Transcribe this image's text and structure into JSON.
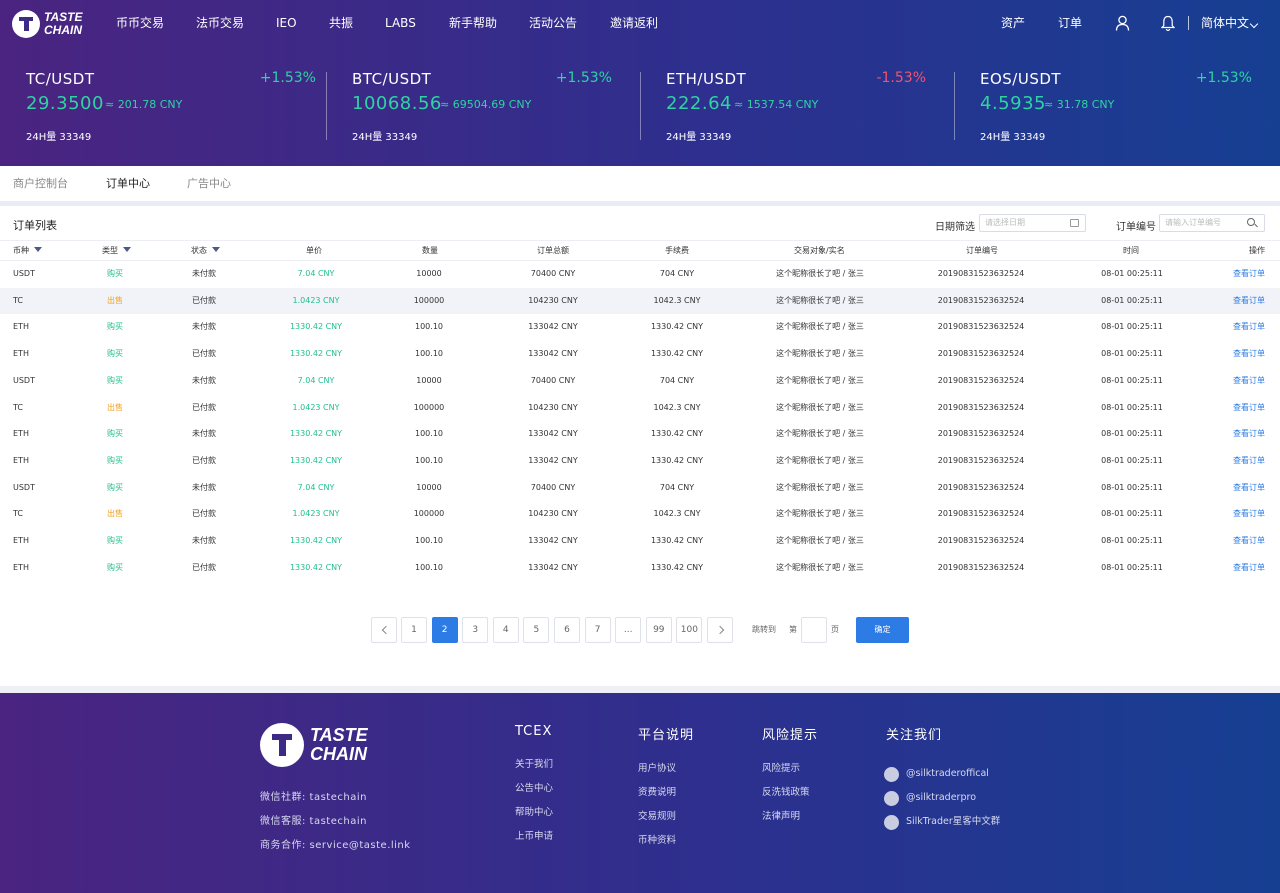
{
  "brand": {
    "line1": "TASTE",
    "line2": "CHAIN"
  },
  "nav": {
    "items": [
      "币币交易",
      "法币交易",
      "IEO",
      "共振",
      "LABS",
      "新手帮助",
      "活动公告",
      "邀请返利"
    ],
    "assets": "资产",
    "orders": "订单",
    "language": "简体中文",
    "user_icon": "user-icon",
    "bell_icon": "bell-icon"
  },
  "tickers": [
    {
      "pair": "TC/USDT",
      "change": "+1.53%",
      "change_color": "#2fd3a3",
      "price": "29.3500",
      "cny": "≈ 201.78 CNY",
      "volume": "24H量 33349"
    },
    {
      "pair": "BTC/USDT",
      "change": "+1.53%",
      "change_color": "#2fd3a3",
      "price": "10068.56",
      "cny": "≈ 69504.69 CNY",
      "volume": "24H量 33349"
    },
    {
      "pair": "ETH/USDT",
      "change": "-1.53%",
      "change_color": "#f2536b",
      "price": "222.64",
      "cny": "≈ 1537.54 CNY",
      "volume": "24H量 33349"
    },
    {
      "pair": "EOS/USDT",
      "change": "+1.53%",
      "change_color": "#2fd3a3",
      "price": "4.5935",
      "cny": "≈ 31.78 CNY",
      "volume": "24H量 33349"
    }
  ],
  "tabs": [
    "商户控制台",
    "订单中心",
    "广告中心"
  ],
  "active_tab": 1,
  "list": {
    "title": "订单列表",
    "date_label": "日期筛选",
    "date_placeholder": "请选择日期",
    "order_label": "订单编号",
    "order_placeholder": "请输入订单编号"
  },
  "columns": [
    "币种",
    "类型",
    "状态",
    "单价",
    "数量",
    "订单总额",
    "手续费",
    "交易对象/实名",
    "订单编号",
    "时间",
    "操作"
  ],
  "rows": [
    {
      "coin": "USDT",
      "type": "购买",
      "status": "未付款",
      "price": "7.04 CNY",
      "qty": "10000",
      "total": "70400 CNY",
      "fee": "704 CNY",
      "party": "这个昵称很长了吧 / 张三",
      "order_no": "20190831523632524",
      "time": "08-01 00:25:11",
      "action": "查看订单"
    },
    {
      "coin": "TC",
      "type": "出售",
      "status": "已付款",
      "price": "1.0423 CNY",
      "qty": "100000",
      "total": "104230 CNY",
      "fee": "1042.3 CNY",
      "party": "这个昵称很长了吧 / 张三",
      "order_no": "20190831523632524",
      "time": "08-01 00:25:11",
      "action": "查看订单"
    },
    {
      "coin": "ETH",
      "type": "购买",
      "status": "未付款",
      "price": "1330.42 CNY",
      "qty": "100.10",
      "total": "133042 CNY",
      "fee": "1330.42 CNY",
      "party": "这个昵称很长了吧 / 张三",
      "order_no": "20190831523632524",
      "time": "08-01 00:25:11",
      "action": "查看订单"
    },
    {
      "coin": "ETH",
      "type": "购买",
      "status": "已付款",
      "price": "1330.42 CNY",
      "qty": "100.10",
      "total": "133042 CNY",
      "fee": "1330.42 CNY",
      "party": "这个昵称很长了吧 / 张三",
      "order_no": "20190831523632524",
      "time": "08-01 00:25:11",
      "action": "查看订单"
    },
    {
      "coin": "USDT",
      "type": "购买",
      "status": "未付款",
      "price": "7.04 CNY",
      "qty": "10000",
      "total": "70400 CNY",
      "fee": "704 CNY",
      "party": "这个昵称很长了吧 / 张三",
      "order_no": "20190831523632524",
      "time": "08-01 00:25:11",
      "action": "查看订单"
    },
    {
      "coin": "TC",
      "type": "出售",
      "status": "已付款",
      "price": "1.0423 CNY",
      "qty": "100000",
      "total": "104230 CNY",
      "fee": "1042.3 CNY",
      "party": "这个昵称很长了吧 / 张三",
      "order_no": "20190831523632524",
      "time": "08-01 00:25:11",
      "action": "查看订单"
    },
    {
      "coin": "ETH",
      "type": "购买",
      "status": "未付款",
      "price": "1330.42 CNY",
      "qty": "100.10",
      "total": "133042 CNY",
      "fee": "1330.42 CNY",
      "party": "这个昵称很长了吧 / 张三",
      "order_no": "20190831523632524",
      "time": "08-01 00:25:11",
      "action": "查看订单"
    },
    {
      "coin": "ETH",
      "type": "购买",
      "status": "已付款",
      "price": "1330.42 CNY",
      "qty": "100.10",
      "total": "133042 CNY",
      "fee": "1330.42 CNY",
      "party": "这个昵称很长了吧 / 张三",
      "order_no": "20190831523632524",
      "time": "08-01 00:25:11",
      "action": "查看订单"
    },
    {
      "coin": "USDT",
      "type": "购买",
      "status": "未付款",
      "price": "7.04 CNY",
      "qty": "10000",
      "total": "70400 CNY",
      "fee": "704 CNY",
      "party": "这个昵称很长了吧 / 张三",
      "order_no": "20190831523632524",
      "time": "08-01 00:25:11",
      "action": "查看订单"
    },
    {
      "coin": "TC",
      "type": "出售",
      "status": "已付款",
      "price": "1.0423 CNY",
      "qty": "100000",
      "total": "104230 CNY",
      "fee": "1042.3 CNY",
      "party": "这个昵称很长了吧 / 张三",
      "order_no": "20190831523632524",
      "time": "08-01 00:25:11",
      "action": "查看订单"
    },
    {
      "coin": "ETH",
      "type": "购买",
      "status": "未付款",
      "price": "1330.42 CNY",
      "qty": "100.10",
      "total": "133042 CNY",
      "fee": "1330.42 CNY",
      "party": "这个昵称很长了吧 / 张三",
      "order_no": "20190831523632524",
      "time": "08-01 00:25:11",
      "action": "查看订单"
    },
    {
      "coin": "ETH",
      "type": "购买",
      "status": "已付款",
      "price": "1330.42 CNY",
      "qty": "100.10",
      "total": "133042 CNY",
      "fee": "1330.42 CNY",
      "party": "这个昵称很长了吧 / 张三",
      "order_no": "20190831523632524",
      "time": "08-01 00:25:11",
      "action": "查看订单"
    }
  ],
  "highlighted_row": 1,
  "pagination": {
    "pages": [
      "1",
      "2",
      "3",
      "4",
      "5",
      "6",
      "7",
      "...",
      "99",
      "100"
    ],
    "current": "2",
    "jump_to": "跳转到",
    "page_prefix": "第",
    "page_suffix": "页",
    "confirm": "确定"
  },
  "footer": {
    "brand": {
      "line1": "TASTE",
      "line2": "CHAIN"
    },
    "info": [
      "微信社群: tastechain",
      "微信客服: tastechain",
      "商务合作: service@taste.link"
    ],
    "columns": [
      {
        "title": "TCEX",
        "links": [
          "关于我们",
          "公告中心",
          "帮助中心",
          "上币申请"
        ]
      },
      {
        "title": "平台说明",
        "links": [
          "用户协议",
          "资费说明",
          "交易规则",
          "币种资料"
        ]
      },
      {
        "title": "风险提示",
        "links": [
          "风险提示",
          "反洗钱政策",
          "法律声明"
        ]
      },
      {
        "title": "关注我们",
        "links": [
          "@silktraderoffical",
          "@silktraderpro",
          "SilkTrader星客中文群"
        ]
      }
    ]
  }
}
